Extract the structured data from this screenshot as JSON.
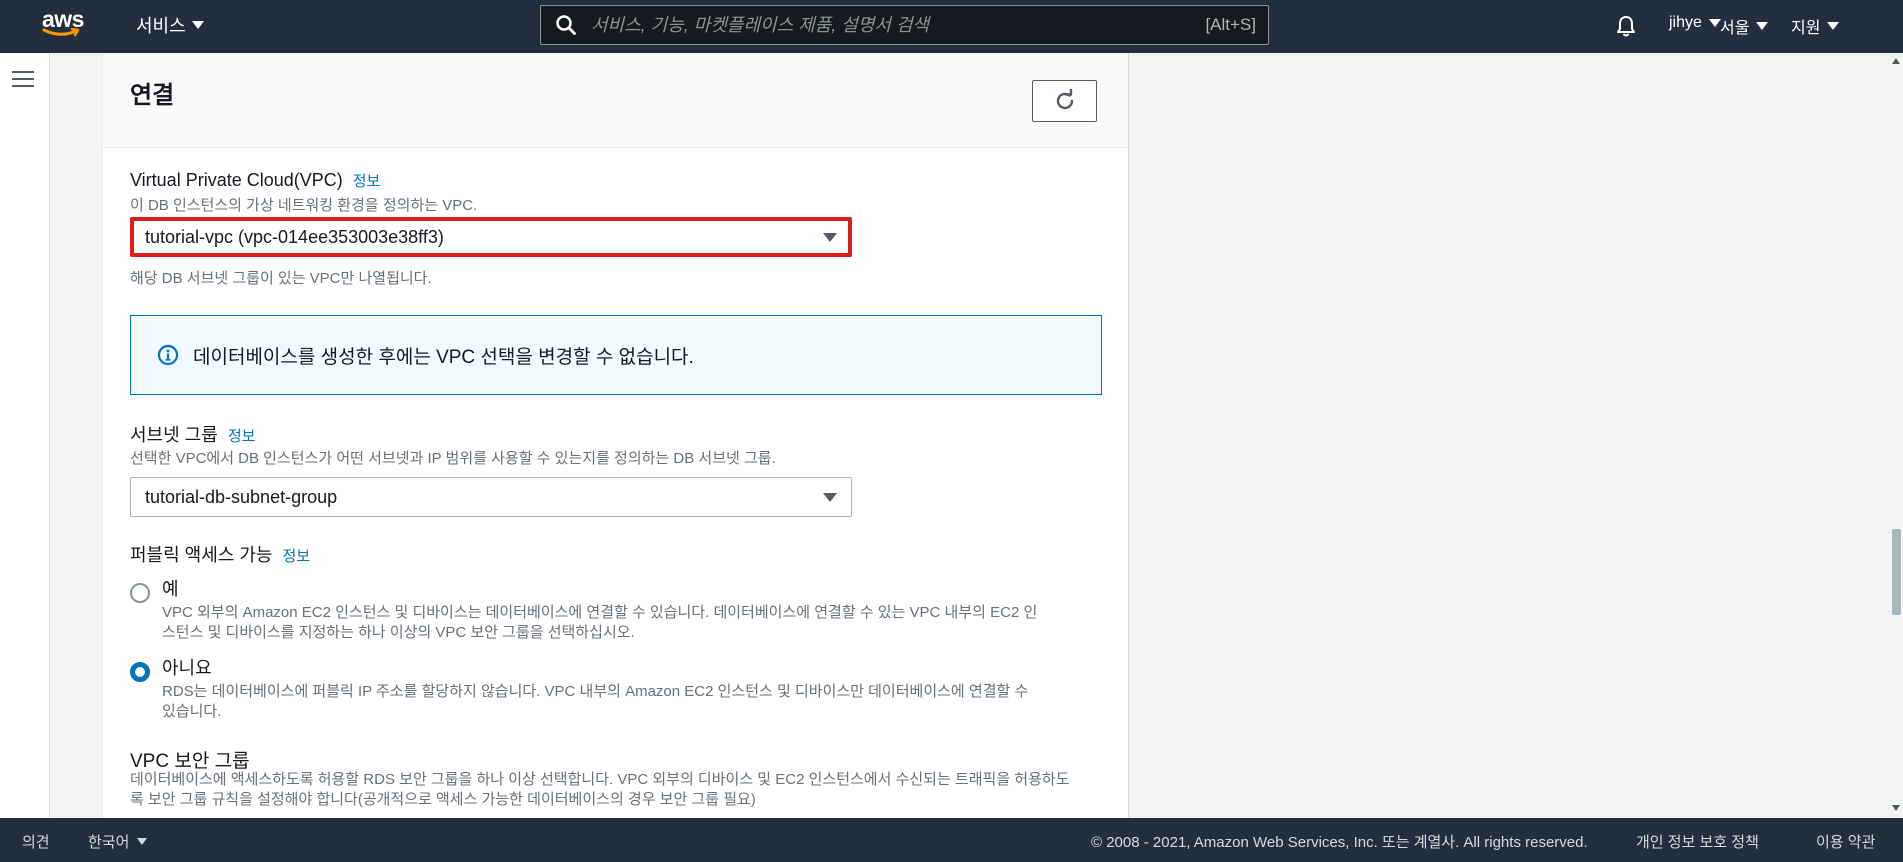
{
  "nav": {
    "logo_text": "aws",
    "services_label": "서비스",
    "search_placeholder": "서비스, 기능, 마켓플레이스 제품, 설명서 검색",
    "search_shortcut": "[Alt+S]",
    "user_label": "jihye",
    "region_label": "서울",
    "support_label": "지원"
  },
  "panel": {
    "title": "연결",
    "vpc": {
      "label": "Virtual Private Cloud(VPC)",
      "info": "정보",
      "description": "이 DB 인스턴스의 가상 네트워킹 환경을 정의하는 VPC.",
      "selected": "tutorial-vpc (vpc-014ee353003e38ff3)",
      "hint": "해당 DB 서브넷 그룹이 있는 VPC만 나열됩니다."
    },
    "alert_text": "데이터베이스를 생성한 후에는 VPC 선택을 변경할 수 없습니다.",
    "subnet": {
      "label": "서브넷 그룹",
      "info": "정보",
      "description": "선택한 VPC에서 DB 인스턴스가 어떤 서브넷과 IP 범위를 사용할 수 있는지를 정의하는 DB 서브넷 그룹.",
      "selected": "tutorial-db-subnet-group"
    },
    "public_access": {
      "label": "퍼블릭 액세스 가능",
      "info": "정보",
      "options": [
        {
          "label": "예",
          "description": "VPC 외부의 Amazon EC2 인스턴스 및 디바이스는 데이터베이스에 연결할 수 있습니다. 데이터베이스에 연결할 수 있는 VPC 내부의 EC2 인스턴스 및 디바이스를 지정하는 하나 이상의 VPC 보안 그룹을 선택하십시오.",
          "checked": false
        },
        {
          "label": "아니요",
          "description": "RDS는 데이터베이스에 퍼블릭 IP 주소를 할당하지 않습니다. VPC 내부의 Amazon EC2 인스턴스 및 디바이스만 데이터베이스에 연결할 수 있습니다.",
          "checked": true
        }
      ]
    },
    "security_group": {
      "label": "VPC 보안 그룹",
      "description": "데이터베이스에 액세스하도록 허용할 RDS 보안 그룹을 하나 이상 선택합니다. VPC 외부의 디바이스 및 EC2 인스턴스에서 수신되는 트래픽을 허용하도록 보안 그룹 규칙을 설정해야 합니다(공개적으로 액세스 가능한 데이터베이스의 경우 보안 그룹 필요)"
    }
  },
  "footer": {
    "feedback": "의견",
    "language": "한국어",
    "copyright": "© 2008 - 2021, Amazon Web Services, Inc. 또는 계열사. All rights reserved.",
    "privacy": "개인 정보 보호 정책",
    "terms": "이용 약관"
  },
  "colors": {
    "nav_bg": "#232f3e",
    "link": "#0073bb",
    "highlight_border": "#dd1b1b",
    "alert_bg": "#f1faff"
  }
}
